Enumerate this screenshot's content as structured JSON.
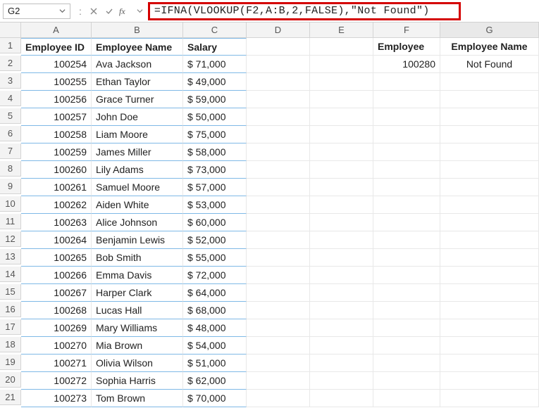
{
  "namebox": {
    "cell": "G2"
  },
  "formula_bar": {
    "formula": "=IFNA(VLOOKUP(F2,A:B,2,FALSE),\"Not Found\")",
    "sep": ":"
  },
  "col_headers": [
    "A",
    "B",
    "C",
    "D",
    "E",
    "F",
    "G"
  ],
  "headers": {
    "A": "Employee ID",
    "B": "Employee Name",
    "C": "Salary",
    "F": "Employee",
    "G": "Employee Name"
  },
  "lookup": {
    "F2": "100280",
    "G2": "Not Found"
  },
  "rows": [
    {
      "n": 1
    },
    {
      "n": 2,
      "id": "100254",
      "name": "Ava Jackson",
      "sal": " $ 71,000 "
    },
    {
      "n": 3,
      "id": "100255",
      "name": "Ethan Taylor",
      "sal": " $ 49,000 "
    },
    {
      "n": 4,
      "id": "100256",
      "name": "Grace Turner",
      "sal": " $ 59,000 "
    },
    {
      "n": 5,
      "id": "100257",
      "name": "John Doe",
      "sal": " $ 50,000 "
    },
    {
      "n": 6,
      "id": "100258",
      "name": "Liam Moore",
      "sal": " $ 75,000 "
    },
    {
      "n": 7,
      "id": "100259",
      "name": "James Miller",
      "sal": " $ 58,000 "
    },
    {
      "n": 8,
      "id": "100260",
      "name": "Lily Adams",
      "sal": " $ 73,000 "
    },
    {
      "n": 9,
      "id": "100261",
      "name": "Samuel Moore",
      "sal": " $ 57,000 "
    },
    {
      "n": 10,
      "id": "100262",
      "name": "Aiden White",
      "sal": " $ 53,000 "
    },
    {
      "n": 11,
      "id": "100263",
      "name": "Alice Johnson",
      "sal": " $ 60,000 "
    },
    {
      "n": 12,
      "id": "100264",
      "name": "Benjamin Lewis",
      "sal": " $ 52,000 "
    },
    {
      "n": 13,
      "id": "100265",
      "name": "Bob Smith",
      "sal": " $ 55,000 "
    },
    {
      "n": 14,
      "id": "100266",
      "name": "Emma Davis",
      "sal": " $ 72,000 "
    },
    {
      "n": 15,
      "id": "100267",
      "name": "Harper Clark",
      "sal": " $ 64,000 "
    },
    {
      "n": 16,
      "id": "100268",
      "name": "Lucas Hall",
      "sal": " $ 68,000 "
    },
    {
      "n": 17,
      "id": "100269",
      "name": "Mary Williams",
      "sal": " $ 48,000 "
    },
    {
      "n": 18,
      "id": "100270",
      "name": "Mia Brown",
      "sal": " $ 54,000 "
    },
    {
      "n": 19,
      "id": "100271",
      "name": "Olivia Wilson",
      "sal": " $ 51,000 "
    },
    {
      "n": 20,
      "id": "100272",
      "name": "Sophia Harris",
      "sal": " $ 62,000 "
    },
    {
      "n": 21,
      "id": "100273",
      "name": "Tom Brown",
      "sal": " $ 70,000 "
    }
  ]
}
